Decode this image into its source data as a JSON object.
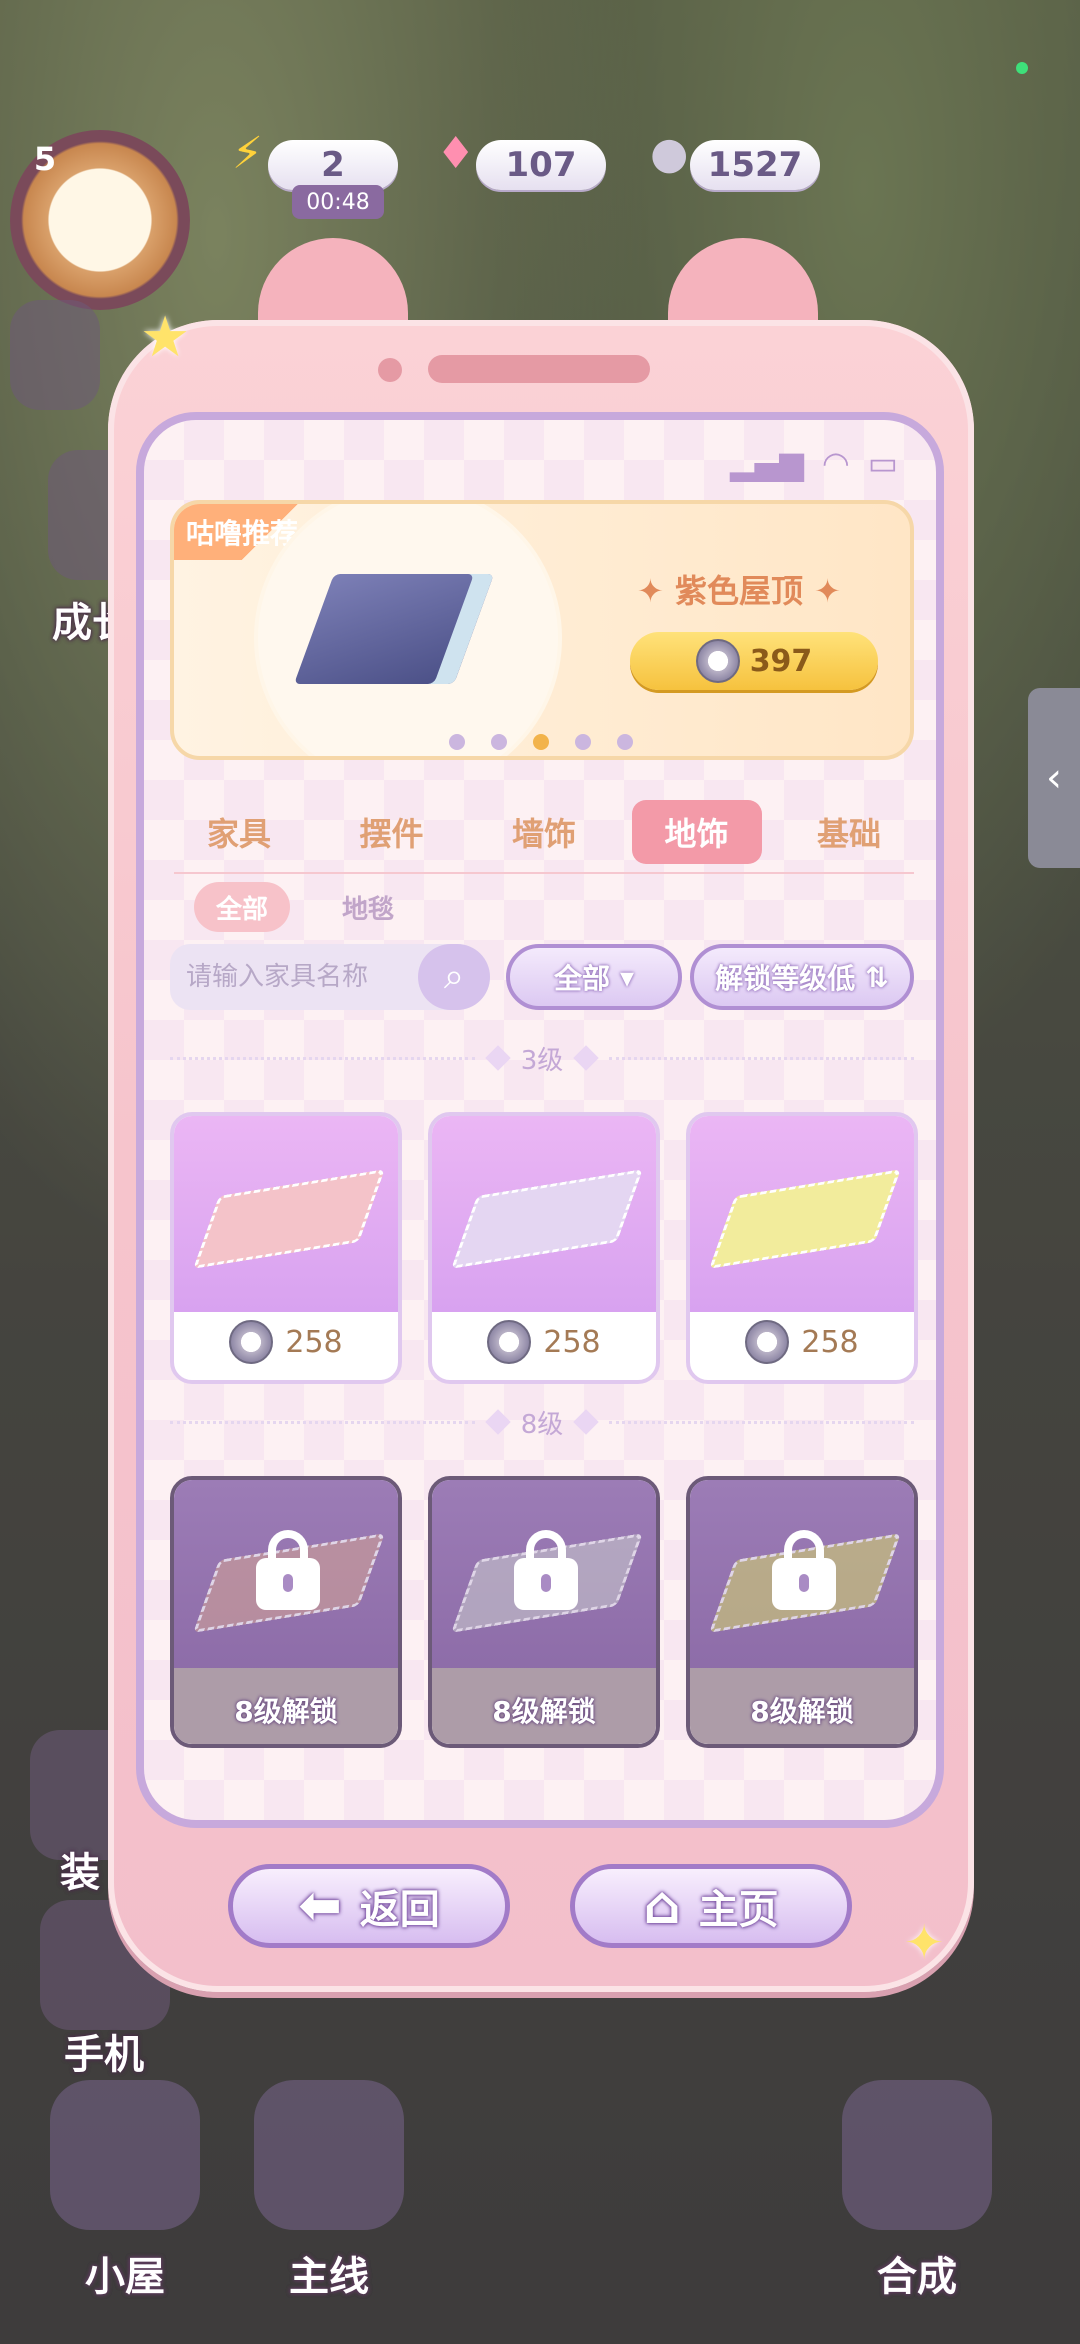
{
  "top_bar": {
    "level": "5",
    "energy": "2",
    "energy_timer": "00:48",
    "gems": "107",
    "coins": "1527"
  },
  "side_labels": {
    "growth": "成长",
    "decorate": "装",
    "phone": "手机",
    "collapse_icon": "chevron-left-icon"
  },
  "featured": {
    "tag": "咕噜推荐",
    "name": "✦ 紫色屋顶 ✦",
    "price": "397",
    "page_dots": 5,
    "active_dot": 3
  },
  "categories": {
    "tabs": [
      "家具",
      "摆件",
      "墙饰",
      "地饰",
      "基础"
    ],
    "active": "地饰"
  },
  "subcategories": {
    "tabs": [
      "全部",
      "地毯"
    ],
    "active": "全部"
  },
  "search": {
    "placeholder": "请输入家具名称",
    "filter_all": "全部",
    "sort_label": "解锁等级低"
  },
  "sections": [
    {
      "level_label": "3级",
      "items": [
        {
          "price": "258",
          "color": "#f4c3c9"
        },
        {
          "price": "258",
          "color": "#e4d6f2"
        },
        {
          "price": "258",
          "color": "#f2ec9c"
        }
      ]
    },
    {
      "level_label": "8级",
      "items": [
        {
          "locked_text": "8级解锁",
          "color": "#c79a9a"
        },
        {
          "locked_text": "8级解锁",
          "color": "#bfbac7"
        },
        {
          "locked_text": "8级解锁",
          "color": "#c8c27a"
        }
      ]
    }
  ],
  "buttons": {
    "back": "返回",
    "home": "主页"
  },
  "bottom_nav": {
    "house": "小屋",
    "main_quest": "主线",
    "merge": "合成"
  }
}
